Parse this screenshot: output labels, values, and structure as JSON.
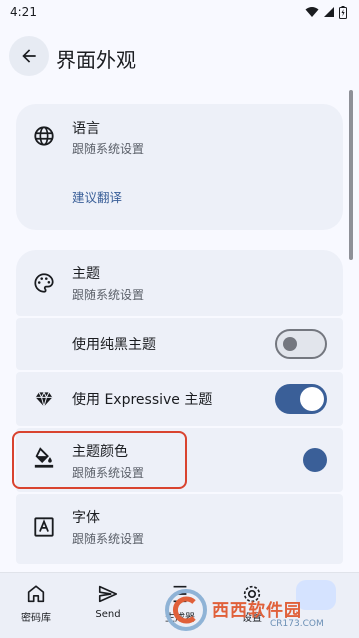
{
  "status_bar": {
    "time": "4:21"
  },
  "app_bar": {
    "title": "界面外观"
  },
  "language_card": {
    "title": "语言",
    "subtitle": "跟随系统设置",
    "link": "建议翻译"
  },
  "theme_card": {
    "theme": {
      "title": "主题",
      "subtitle": "跟随系统设置"
    },
    "pure_black": {
      "title": "使用纯黑主题",
      "enabled": false
    },
    "expressive": {
      "title": "使用 Expressive 主题",
      "enabled": true
    },
    "theme_color": {
      "title": "主题颜色",
      "subtitle": "跟随系统设置",
      "color": "#3a5f98"
    },
    "font": {
      "title": "字体",
      "subtitle": "跟随系统设置"
    }
  },
  "colors": {
    "accent": "#3a5f98",
    "highlight_border": "#d9432f"
  },
  "bottom_nav": {
    "items": [
      {
        "icon": "home-icon",
        "label": "密码库"
      },
      {
        "icon": "send-icon",
        "label": "Send"
      },
      {
        "icon": "generator-icon",
        "label": "生成器"
      },
      {
        "icon": "settings-icon",
        "label": "设置"
      }
    ]
  },
  "watermark": {
    "text": "西西软件园",
    "subtext": "CR173.COM"
  }
}
